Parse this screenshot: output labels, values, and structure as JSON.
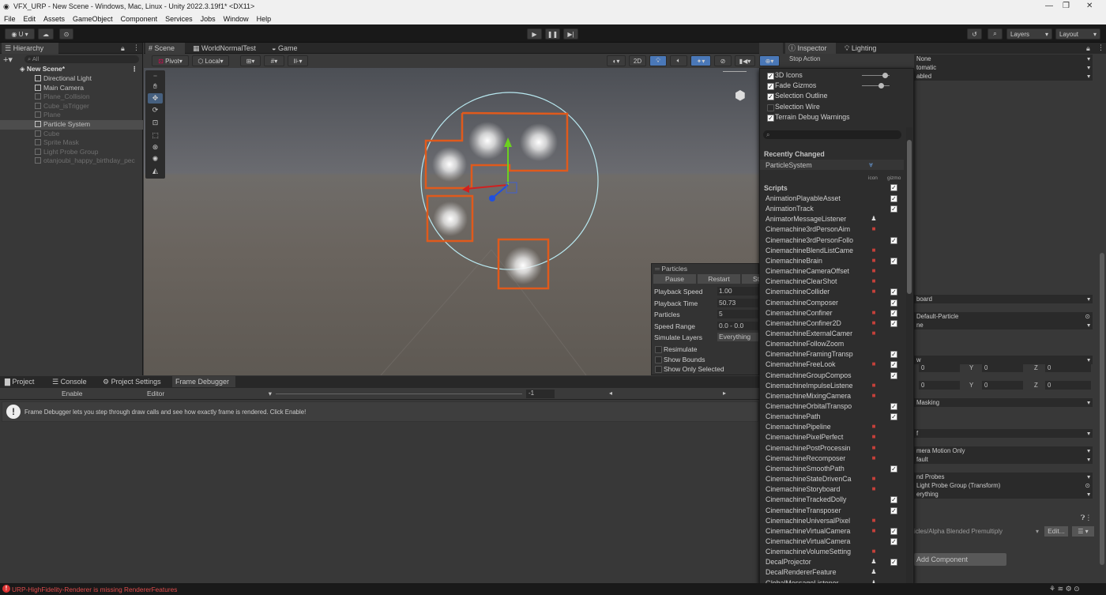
{
  "window": {
    "title": "VFX_URP - New Scene - Windows, Mac, Linux - Unity 2022.3.19f1* <DX11>"
  },
  "menu": [
    "File",
    "Edit",
    "Assets",
    "GameObject",
    "Component",
    "Services",
    "Jobs",
    "Window",
    "Help"
  ],
  "toolbar": {
    "account": "U",
    "layers": "Layers",
    "layout": "Layout"
  },
  "hierarchy": {
    "tab": "Hierarchy",
    "search_placeholder": "All",
    "scene": "New Scene*",
    "items": [
      {
        "label": "Directional Light",
        "dim": false
      },
      {
        "label": "Main Camera",
        "dim": false
      },
      {
        "label": "Plane_Collision",
        "dim": true
      },
      {
        "label": "Cube_isTrigger",
        "dim": true
      },
      {
        "label": "Plane",
        "dim": true
      },
      {
        "label": "Particle System",
        "dim": false,
        "selected": true
      },
      {
        "label": "Cube",
        "dim": true
      },
      {
        "label": "Sprite Mask",
        "dim": true
      },
      {
        "label": "Light Probe Group",
        "dim": true
      },
      {
        "label": "otanjoubi_happy_birthday_pec",
        "dim": true
      }
    ]
  },
  "scene_tabs": [
    "Scene",
    "WorldNormalTest",
    "Game"
  ],
  "scene_toolbar": {
    "pivot": "Pivot",
    "local": "Local",
    "mode_2d": "2D"
  },
  "particles": {
    "title": "Particles",
    "buttons": [
      "Pause",
      "Restart",
      "St"
    ],
    "rows": [
      {
        "label": "Playback Speed",
        "value": "1.00"
      },
      {
        "label": "Playback Time",
        "value": "50.73"
      },
      {
        "label": "Particles",
        "value": "5"
      },
      {
        "label": "Speed Range",
        "value": "0.0 - 0.0"
      },
      {
        "label": "Simulate Layers",
        "value": "Everything"
      }
    ],
    "toggles": [
      "Resimulate",
      "Show Bounds",
      "Show Only Selected"
    ]
  },
  "bottom_tabs": [
    "Project",
    "Console",
    "Project Settings",
    "Frame Debugger"
  ],
  "frame_debugger": {
    "enable": "Enable",
    "editor": "Editor",
    "counter": "-1",
    "message": "Frame Debugger lets you step through draw calls and see how exactly frame is rendered. Click Enable!"
  },
  "inspector_tabs": [
    "Inspector",
    "Lighting"
  ],
  "gizmos": {
    "top_toggles": [
      {
        "label": "3D Icons",
        "checked": true
      },
      {
        "label": "Fade Gizmos",
        "checked": true
      },
      {
        "label": "Selection Outline",
        "checked": true
      },
      {
        "label": "Selection Wire",
        "checked": false
      },
      {
        "label": "Terrain Debug Warnings",
        "checked": true
      }
    ],
    "recently_changed": "Recently Changed",
    "recent_item": "ParticleSystem",
    "scripts_header": "Scripts",
    "col_icon": "icon",
    "col_gizmo": "gizmo",
    "scripts": [
      {
        "name": "AnimationPlayableAsset",
        "icon": "",
        "gizmo": true
      },
      {
        "name": "AnimationTrack",
        "icon": "",
        "gizmo": true
      },
      {
        "name": "AnimatorMessageListener",
        "icon": "white",
        "gizmo": false
      },
      {
        "name": "Cinemachine3rdPersonAim",
        "icon": "red",
        "gizmo": false
      },
      {
        "name": "Cinemachine3rdPersonFollo",
        "icon": "",
        "gizmo": true
      },
      {
        "name": "CinemachineBlendListCame",
        "icon": "red",
        "gizmo": false
      },
      {
        "name": "CinemachineBrain",
        "icon": "red",
        "gizmo": true
      },
      {
        "name": "CinemachineCameraOffset",
        "icon": "red",
        "gizmo": false
      },
      {
        "name": "CinemachineClearShot",
        "icon": "red",
        "gizmo": false
      },
      {
        "name": "CinemachineCollider",
        "icon": "red",
        "gizmo": true
      },
      {
        "name": "CinemachineComposer",
        "icon": "",
        "gizmo": true
      },
      {
        "name": "CinemachineConfiner",
        "icon": "red",
        "gizmo": true
      },
      {
        "name": "CinemachineConfiner2D",
        "icon": "red",
        "gizmo": true
      },
      {
        "name": "CinemachineExternalCamer",
        "icon": "red",
        "gizmo": false
      },
      {
        "name": "CinemachineFollowZoom",
        "icon": "",
        "gizmo": false
      },
      {
        "name": "CinemachineFramingTransp",
        "icon": "",
        "gizmo": true
      },
      {
        "name": "CinemachineFreeLook",
        "icon": "red",
        "gizmo": true
      },
      {
        "name": "CinemachineGroupCompos",
        "icon": "",
        "gizmo": true
      },
      {
        "name": "CinemachineImpulseListene",
        "icon": "red",
        "gizmo": false
      },
      {
        "name": "CinemachineMixingCamera",
        "icon": "red",
        "gizmo": false
      },
      {
        "name": "CinemachineOrbitalTranspo",
        "icon": "",
        "gizmo": true
      },
      {
        "name": "CinemachinePath",
        "icon": "",
        "gizmo": true
      },
      {
        "name": "CinemachinePipeline",
        "icon": "red",
        "gizmo": false
      },
      {
        "name": "CinemachinePixelPerfect",
        "icon": "red",
        "gizmo": false
      },
      {
        "name": "CinemachinePostProcessin",
        "icon": "red",
        "gizmo": false
      },
      {
        "name": "CinemachineRecomposer",
        "icon": "red",
        "gizmo": false
      },
      {
        "name": "CinemachineSmoothPath",
        "icon": "",
        "gizmo": true
      },
      {
        "name": "CinemachineStateDrivenCa",
        "icon": "red",
        "gizmo": false
      },
      {
        "name": "CinemachineStoryboard",
        "icon": "red",
        "gizmo": false
      },
      {
        "name": "CinemachineTrackedDolly",
        "icon": "",
        "gizmo": true
      },
      {
        "name": "CinemachineTransposer",
        "icon": "",
        "gizmo": true
      },
      {
        "name": "CinemachineUniversalPixel",
        "icon": "red",
        "gizmo": false
      },
      {
        "name": "CinemachineVirtualCamera",
        "icon": "red",
        "gizmo": true
      },
      {
        "name": "CinemachineVirtualCamera",
        "icon": "",
        "gizmo": true
      },
      {
        "name": "CinemachineVolumeSetting",
        "icon": "red",
        "gizmo": false
      },
      {
        "name": "DecalProjector",
        "icon": "white",
        "gizmo": true
      },
      {
        "name": "DecalRendererFeature",
        "icon": "white",
        "gizmo": false
      },
      {
        "name": "GlobalMessageListener",
        "icon": "white",
        "gizmo": false
      }
    ]
  },
  "inspector": {
    "stop_action": "Stop Action",
    "stop_value": "None",
    "rows_top": [
      "tomatic",
      "abled"
    ],
    "board": "board",
    "material": "Default-Particle",
    "xyz": {
      "x": "0",
      "y": "0",
      "z": "0"
    },
    "masking": "Masking",
    "motion": "mera Motion Only",
    "fault": "fault",
    "probes": "nd Probes",
    "probe_group": "Light Probe Group (Transform)",
    "everything": "erything",
    "shader": "icles/Alpha Blended Premultiply",
    "edit": "Edit...",
    "add_component": "Add Component"
  },
  "status": {
    "error": "URP-HighFidelity-Renderer is missing RendererFeatures"
  }
}
